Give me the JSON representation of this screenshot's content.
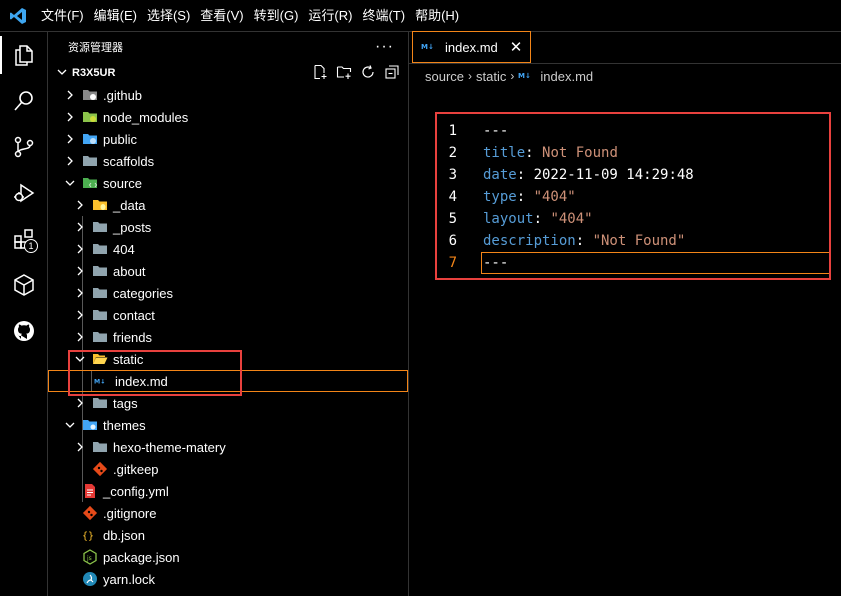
{
  "menu": [
    "文件(F)",
    "编辑(E)",
    "选择(S)",
    "查看(V)",
    "转到(G)",
    "运行(R)",
    "终端(T)",
    "帮助(H)"
  ],
  "activity": {
    "extensions_badge": "1"
  },
  "sidebar": {
    "title": "资源管理器",
    "more": "···",
    "root": "R3X5UR",
    "items": [
      {
        "label": ".github"
      },
      {
        "label": "node_modules"
      },
      {
        "label": "public"
      },
      {
        "label": "scaffolds"
      },
      {
        "label": "source"
      },
      {
        "label": "_data"
      },
      {
        "label": "_posts"
      },
      {
        "label": "404"
      },
      {
        "label": "about"
      },
      {
        "label": "categories"
      },
      {
        "label": "contact"
      },
      {
        "label": "friends"
      },
      {
        "label": "static"
      },
      {
        "label": "index.md"
      },
      {
        "label": "tags"
      },
      {
        "label": "themes"
      },
      {
        "label": "hexo-theme-matery"
      },
      {
        "label": ".gitkeep"
      },
      {
        "label": "_config.yml"
      },
      {
        "label": ".gitignore"
      },
      {
        "label": "db.json"
      },
      {
        "label": "package.json"
      },
      {
        "label": "yarn.lock"
      }
    ]
  },
  "editor": {
    "tab_label": "index.md",
    "tab_close": "✕",
    "breadcrumb": [
      "source",
      "static",
      "index.md"
    ],
    "lines": [
      {
        "num": "1",
        "key": "",
        "sep": "",
        "value": "---"
      },
      {
        "num": "2",
        "key": "title",
        "sep": ": ",
        "value": "Not Found"
      },
      {
        "num": "3",
        "key": "date",
        "sep": ": ",
        "value": "2022-11-09 14:29:48"
      },
      {
        "num": "4",
        "key": "type",
        "sep": ": ",
        "value": "\"404\""
      },
      {
        "num": "5",
        "key": "layout",
        "sep": ": ",
        "value": "\"404\""
      },
      {
        "num": "6",
        "key": "description",
        "sep": ": ",
        "value": "\"Not Found\""
      },
      {
        "num": "7",
        "key": "",
        "sep": "",
        "value": "---"
      }
    ]
  },
  "colors": {
    "accent": "#f38518",
    "highlight_box": "#e8413e",
    "key": "#569cd6",
    "string": "#ce9178"
  }
}
